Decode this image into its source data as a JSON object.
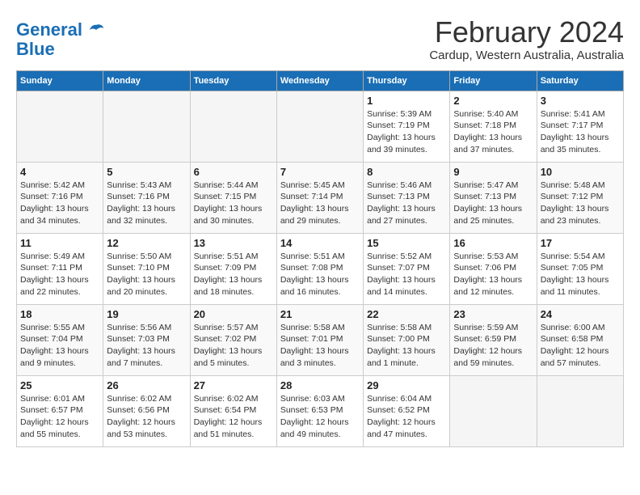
{
  "header": {
    "logo_line1": "General",
    "logo_line2": "Blue",
    "month_year": "February 2024",
    "location": "Cardup, Western Australia, Australia"
  },
  "weekdays": [
    "Sunday",
    "Monday",
    "Tuesday",
    "Wednesday",
    "Thursday",
    "Friday",
    "Saturday"
  ],
  "weeks": [
    [
      {
        "day": "",
        "empty": true
      },
      {
        "day": "",
        "empty": true
      },
      {
        "day": "",
        "empty": true
      },
      {
        "day": "",
        "empty": true
      },
      {
        "day": "1",
        "sunrise": "Sunrise: 5:39 AM",
        "sunset": "Sunset: 7:19 PM",
        "daylight": "Daylight: 13 hours and 39 minutes."
      },
      {
        "day": "2",
        "sunrise": "Sunrise: 5:40 AM",
        "sunset": "Sunset: 7:18 PM",
        "daylight": "Daylight: 13 hours and 37 minutes."
      },
      {
        "day": "3",
        "sunrise": "Sunrise: 5:41 AM",
        "sunset": "Sunset: 7:17 PM",
        "daylight": "Daylight: 13 hours and 35 minutes."
      }
    ],
    [
      {
        "day": "4",
        "sunrise": "Sunrise: 5:42 AM",
        "sunset": "Sunset: 7:16 PM",
        "daylight": "Daylight: 13 hours and 34 minutes."
      },
      {
        "day": "5",
        "sunrise": "Sunrise: 5:43 AM",
        "sunset": "Sunset: 7:16 PM",
        "daylight": "Daylight: 13 hours and 32 minutes."
      },
      {
        "day": "6",
        "sunrise": "Sunrise: 5:44 AM",
        "sunset": "Sunset: 7:15 PM",
        "daylight": "Daylight: 13 hours and 30 minutes."
      },
      {
        "day": "7",
        "sunrise": "Sunrise: 5:45 AM",
        "sunset": "Sunset: 7:14 PM",
        "daylight": "Daylight: 13 hours and 29 minutes."
      },
      {
        "day": "8",
        "sunrise": "Sunrise: 5:46 AM",
        "sunset": "Sunset: 7:13 PM",
        "daylight": "Daylight: 13 hours and 27 minutes."
      },
      {
        "day": "9",
        "sunrise": "Sunrise: 5:47 AM",
        "sunset": "Sunset: 7:13 PM",
        "daylight": "Daylight: 13 hours and 25 minutes."
      },
      {
        "day": "10",
        "sunrise": "Sunrise: 5:48 AM",
        "sunset": "Sunset: 7:12 PM",
        "daylight": "Daylight: 13 hours and 23 minutes."
      }
    ],
    [
      {
        "day": "11",
        "sunrise": "Sunrise: 5:49 AM",
        "sunset": "Sunset: 7:11 PM",
        "daylight": "Daylight: 13 hours and 22 minutes."
      },
      {
        "day": "12",
        "sunrise": "Sunrise: 5:50 AM",
        "sunset": "Sunset: 7:10 PM",
        "daylight": "Daylight: 13 hours and 20 minutes."
      },
      {
        "day": "13",
        "sunrise": "Sunrise: 5:51 AM",
        "sunset": "Sunset: 7:09 PM",
        "daylight": "Daylight: 13 hours and 18 minutes."
      },
      {
        "day": "14",
        "sunrise": "Sunrise: 5:51 AM",
        "sunset": "Sunset: 7:08 PM",
        "daylight": "Daylight: 13 hours and 16 minutes."
      },
      {
        "day": "15",
        "sunrise": "Sunrise: 5:52 AM",
        "sunset": "Sunset: 7:07 PM",
        "daylight": "Daylight: 13 hours and 14 minutes."
      },
      {
        "day": "16",
        "sunrise": "Sunrise: 5:53 AM",
        "sunset": "Sunset: 7:06 PM",
        "daylight": "Daylight: 13 hours and 12 minutes."
      },
      {
        "day": "17",
        "sunrise": "Sunrise: 5:54 AM",
        "sunset": "Sunset: 7:05 PM",
        "daylight": "Daylight: 13 hours and 11 minutes."
      }
    ],
    [
      {
        "day": "18",
        "sunrise": "Sunrise: 5:55 AM",
        "sunset": "Sunset: 7:04 PM",
        "daylight": "Daylight: 13 hours and 9 minutes."
      },
      {
        "day": "19",
        "sunrise": "Sunrise: 5:56 AM",
        "sunset": "Sunset: 7:03 PM",
        "daylight": "Daylight: 13 hours and 7 minutes."
      },
      {
        "day": "20",
        "sunrise": "Sunrise: 5:57 AM",
        "sunset": "Sunset: 7:02 PM",
        "daylight": "Daylight: 13 hours and 5 minutes."
      },
      {
        "day": "21",
        "sunrise": "Sunrise: 5:58 AM",
        "sunset": "Sunset: 7:01 PM",
        "daylight": "Daylight: 13 hours and 3 minutes."
      },
      {
        "day": "22",
        "sunrise": "Sunrise: 5:58 AM",
        "sunset": "Sunset: 7:00 PM",
        "daylight": "Daylight: 13 hours and 1 minute."
      },
      {
        "day": "23",
        "sunrise": "Sunrise: 5:59 AM",
        "sunset": "Sunset: 6:59 PM",
        "daylight": "Daylight: 12 hours and 59 minutes."
      },
      {
        "day": "24",
        "sunrise": "Sunrise: 6:00 AM",
        "sunset": "Sunset: 6:58 PM",
        "daylight": "Daylight: 12 hours and 57 minutes."
      }
    ],
    [
      {
        "day": "25",
        "sunrise": "Sunrise: 6:01 AM",
        "sunset": "Sunset: 6:57 PM",
        "daylight": "Daylight: 12 hours and 55 minutes."
      },
      {
        "day": "26",
        "sunrise": "Sunrise: 6:02 AM",
        "sunset": "Sunset: 6:56 PM",
        "daylight": "Daylight: 12 hours and 53 minutes."
      },
      {
        "day": "27",
        "sunrise": "Sunrise: 6:02 AM",
        "sunset": "Sunset: 6:54 PM",
        "daylight": "Daylight: 12 hours and 51 minutes."
      },
      {
        "day": "28",
        "sunrise": "Sunrise: 6:03 AM",
        "sunset": "Sunset: 6:53 PM",
        "daylight": "Daylight: 12 hours and 49 minutes."
      },
      {
        "day": "29",
        "sunrise": "Sunrise: 6:04 AM",
        "sunset": "Sunset: 6:52 PM",
        "daylight": "Daylight: 12 hours and 47 minutes."
      },
      {
        "day": "",
        "empty": true
      },
      {
        "day": "",
        "empty": true
      }
    ]
  ]
}
